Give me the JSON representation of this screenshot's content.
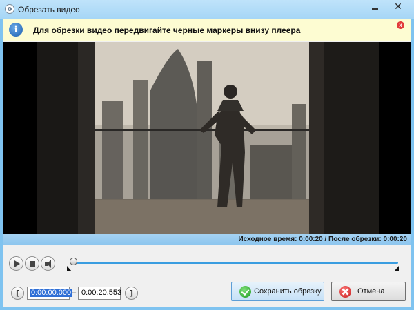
{
  "window": {
    "title": "Обрезать видео",
    "minimize_label": "—",
    "close_label": "✕"
  },
  "info": {
    "icon_letter": "i",
    "message": "Для обрезки видео передвигайте черные маркеры внизу плеера",
    "close_label": "x"
  },
  "status": {
    "text": "Исходное время:  0:00:20 / После обрезки:  0:00:20"
  },
  "transport": {
    "position_fraction": 0.0
  },
  "trim": {
    "start_bracket": "[",
    "end_bracket": "]",
    "start_time": "0:00:00.000",
    "separator": "–",
    "end_time": "0:00:20.553"
  },
  "buttons": {
    "save_label": "Сохранить обрезку",
    "cancel_label": "Отмена"
  },
  "colors": {
    "accent": "#3a9de0",
    "infobar": "#fdfcd2",
    "selection": "#2f6fd6"
  }
}
